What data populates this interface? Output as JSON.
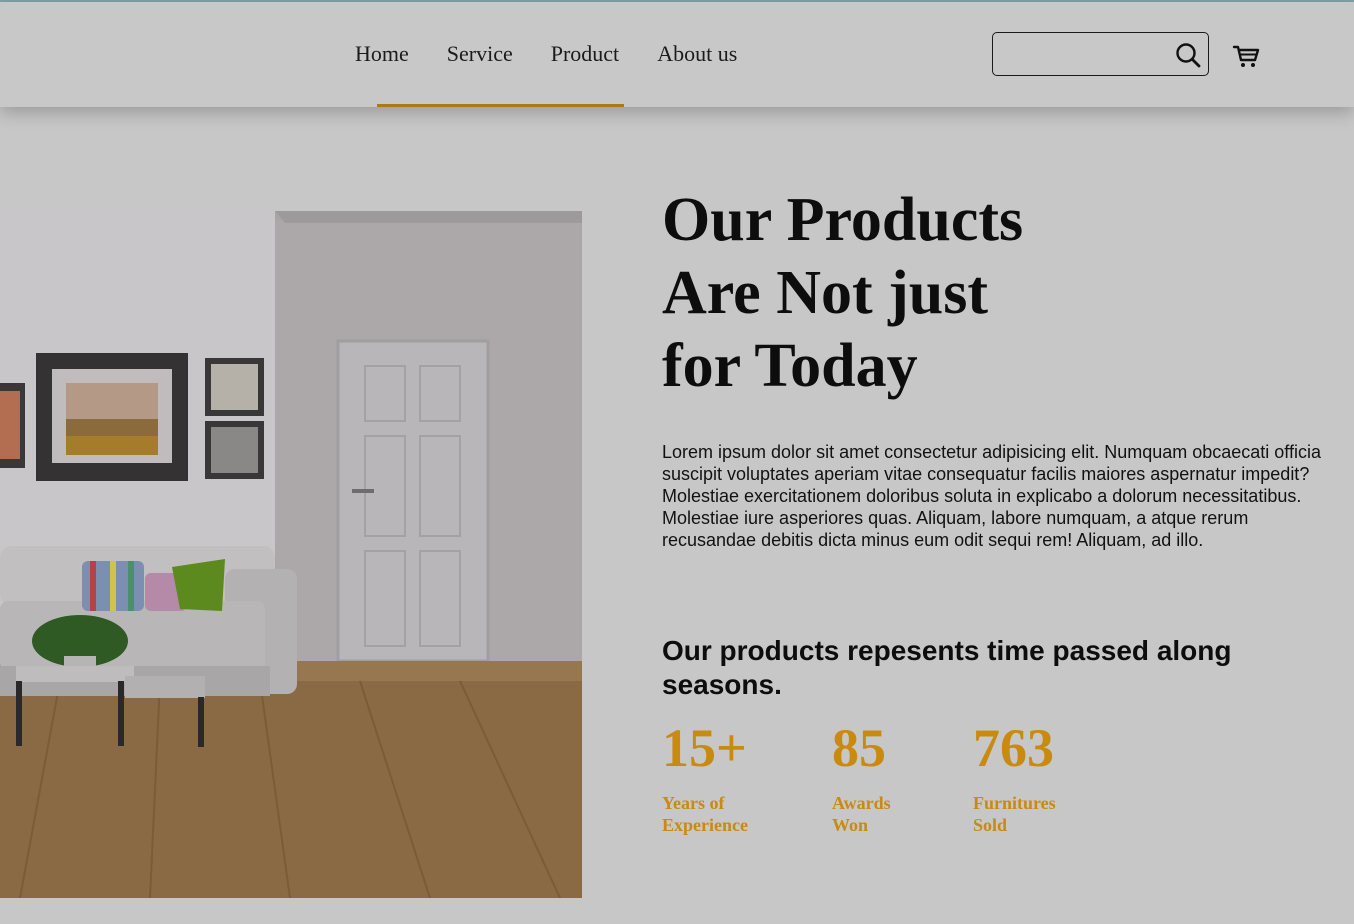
{
  "nav": {
    "items": [
      "Home",
      "Service",
      "Product",
      "About us"
    ]
  },
  "search": {
    "placeholder": ""
  },
  "icons": {
    "search": "search-icon",
    "cart": "cart-icon"
  },
  "hero": {
    "title_lines": [
      "Our Products",
      "Are Not just",
      "for Today"
    ],
    "body": "Lorem ipsum dolor sit amet consectetur adipisicing elit. Numquam obcaecati officia suscipit voluptates aperiam vitae consequatur facilis maiores aspernatur impedit? Molestiae exercitationem doloribus soluta in explicabo a dolorum necessitatibus. Molestiae iure asperiores quas. Aliquam, labore numquam, a atque rerum recusandae debitis dicta minus eum odit sequi rem! Aliquam, ad illo.",
    "subtitle": "Our products repesents time passed along seasons."
  },
  "stats": [
    {
      "number": "15+",
      "label_line1": "Years of",
      "label_line2": "Experience"
    },
    {
      "number": "85",
      "label_line1": "Awards",
      "label_line2": "Won"
    },
    {
      "number": "763",
      "label_line1": "Furnitures",
      "label_line2": "Sold"
    }
  ],
  "colors": {
    "accent": "#c98a10",
    "underline": "#a87d0f",
    "background": "#c7c7c7"
  }
}
